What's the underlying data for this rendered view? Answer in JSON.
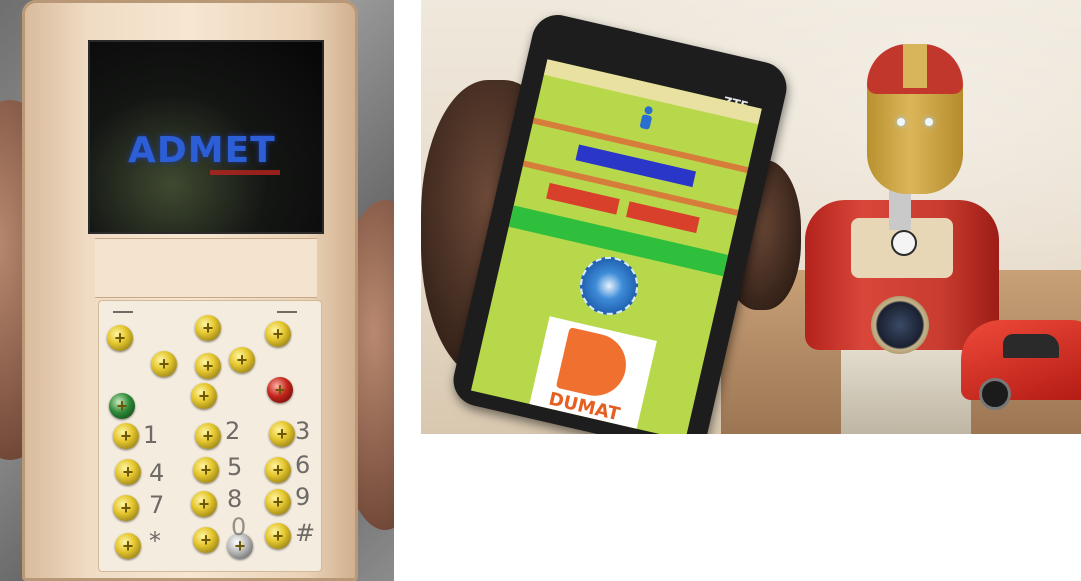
{
  "left_photo": {
    "description_label": "",
    "screen": {
      "logo_text": "ADMET"
    },
    "keypad": {
      "digits": [
        "1",
        "2",
        "3",
        "4",
        "5",
        "6",
        "7",
        "8",
        "9",
        "*",
        "0",
        "#"
      ]
    }
  },
  "right_photo": {
    "phone_brand": "ZTE",
    "app": {
      "logo_text": "DUMAT",
      "primary_button": "",
      "left_red_button": "",
      "right_red_button": ""
    }
  },
  "colors": {
    "logo_blue": "#2c5fd6",
    "screw_gold": "#e6c82f",
    "app_green": "#b8d84c",
    "robot_red": "#c2372b",
    "dumat_orange": "#f07030"
  }
}
